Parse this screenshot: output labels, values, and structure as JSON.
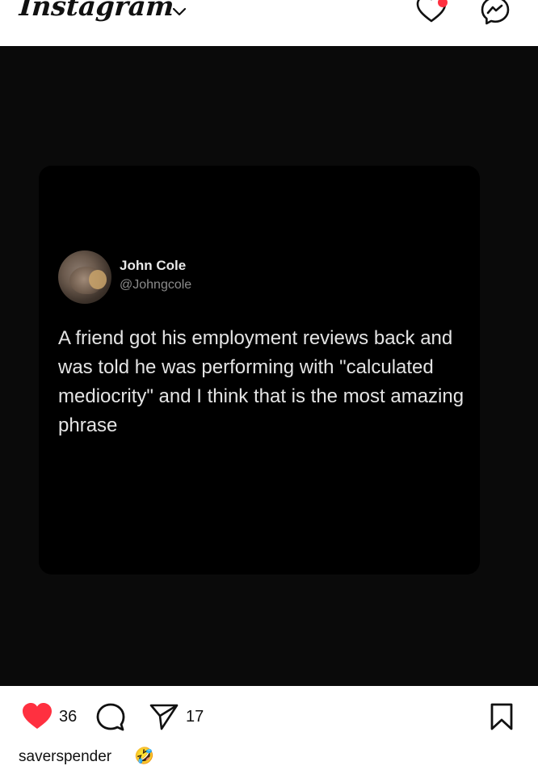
{
  "header": {
    "logo_text": "Instagram",
    "icons": [
      "chevron-down-icon",
      "heart-icon",
      "messenger-icon"
    ],
    "notification_dot_color": "#ff3040"
  },
  "post": {
    "tweet": {
      "author_name": "John Cole",
      "author_handle": "@Johngcole",
      "text": "A friend got his employment reviews back and was told he was performing with \"calculated mediocrity\" and I think that is the most amazing phrase"
    },
    "actions": {
      "like_count": "36",
      "share_count": "17",
      "icons": [
        "heart-filled-icon",
        "comment-icon",
        "share-icon",
        "bookmark-icon"
      ],
      "like_color": "#ff3040"
    },
    "caption": {
      "username": "saverspender",
      "emoji": "🤣"
    }
  },
  "colors": {
    "media_background": "#0a0a0a",
    "card_background": "#000000",
    "tweet_text": "#e4e4e4",
    "handle_text": "#8b8b8b"
  }
}
